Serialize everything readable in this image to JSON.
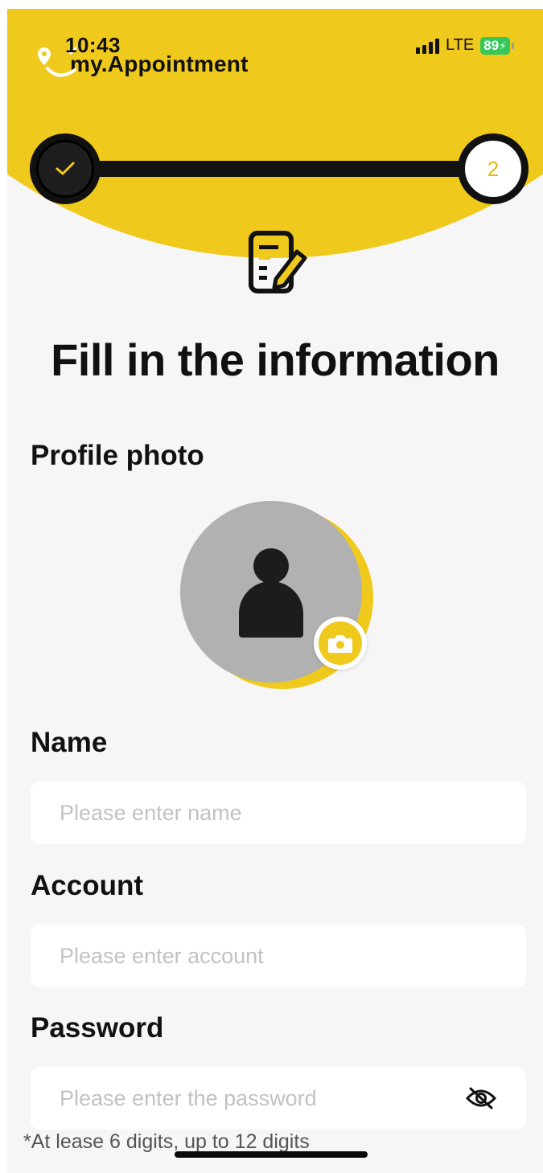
{
  "status_bar": {
    "time": "10:43",
    "network": "LTE",
    "battery": "89"
  },
  "app": {
    "logo_text": "my.Appointment",
    "brand_color": "#f0c91d"
  },
  "stepper": {
    "total_steps": 2,
    "current_step": 2,
    "step_2_label": "2",
    "completed_steps": [
      1
    ]
  },
  "page": {
    "title": "Fill in the information"
  },
  "profile_photo": {
    "label": "Profile photo"
  },
  "form": {
    "name": {
      "label": "Name",
      "value": "",
      "placeholder": "Please enter name"
    },
    "account": {
      "label": "Account",
      "value": "",
      "placeholder": "Please enter account"
    },
    "password": {
      "label": "Password",
      "value": "",
      "placeholder": "Please enter the password",
      "hint": "*At lease 6 digits, up to 12 digits"
    }
  },
  "icons": {
    "logo": "location-smile-logo-icon",
    "step_done": "check-icon",
    "form": "edit-form-icon",
    "avatar": "person-icon",
    "camera": "camera-icon",
    "password_toggle": "eye-off-icon"
  }
}
